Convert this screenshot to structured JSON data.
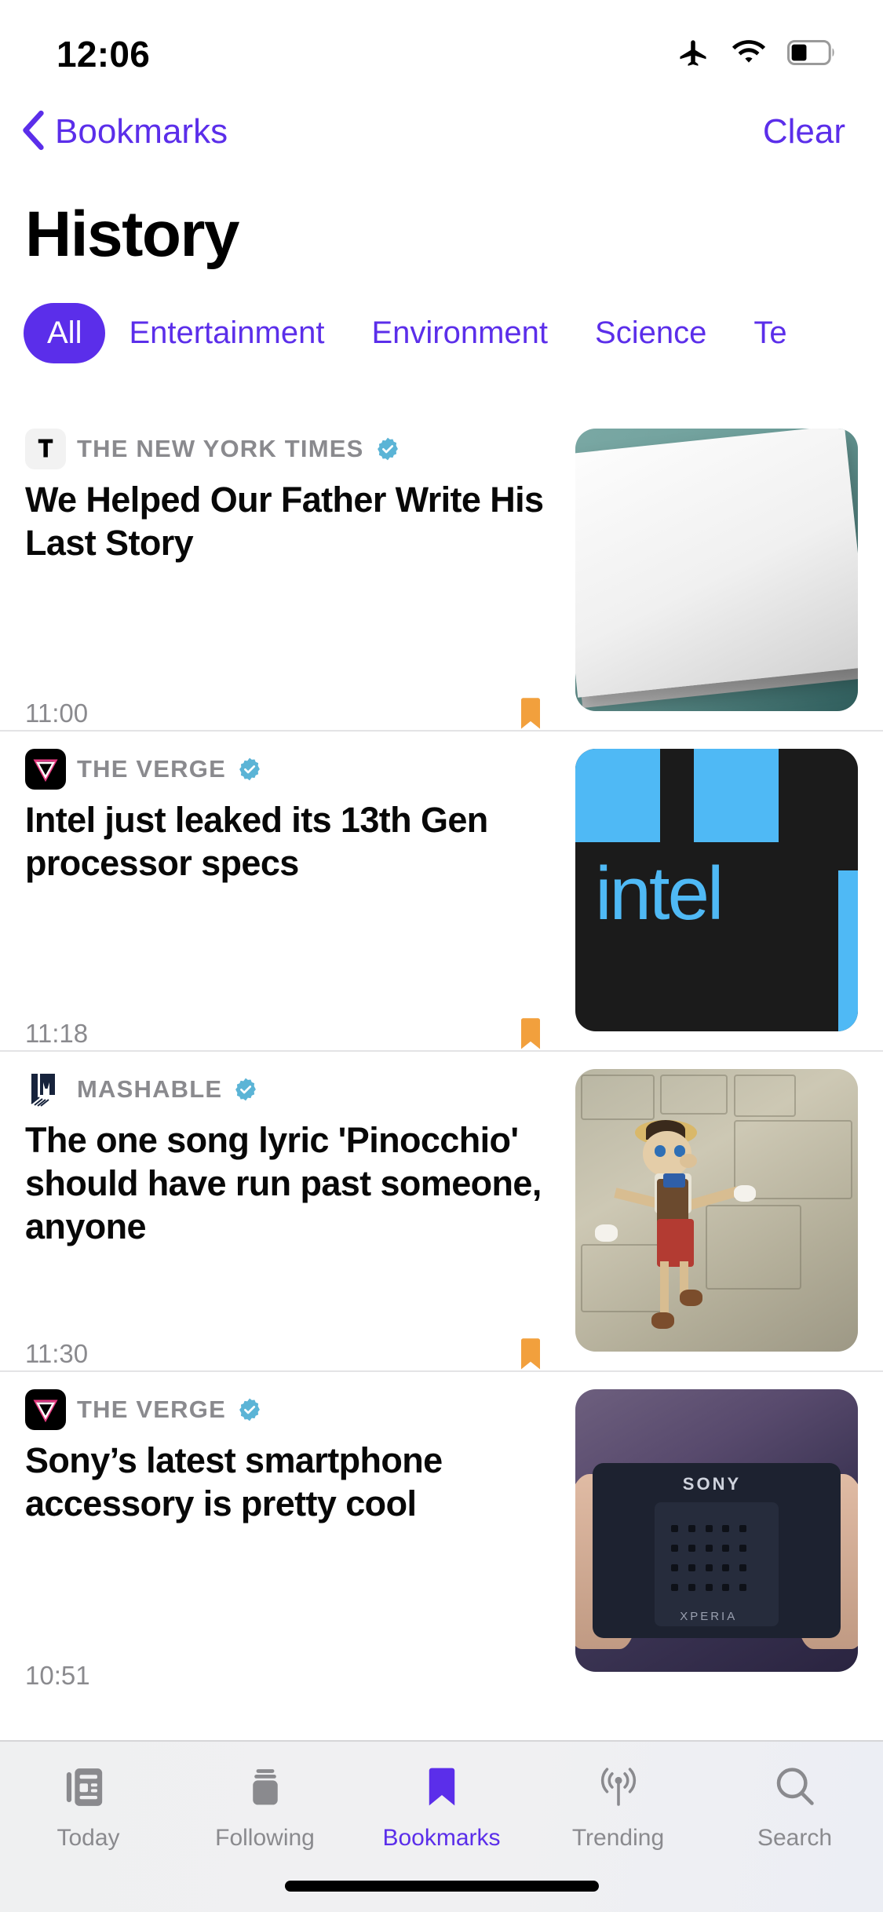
{
  "status_bar": {
    "time": "12:06",
    "icons": [
      "airplane-mode-icon",
      "wifi-icon",
      "battery-icon"
    ],
    "battery_level_pct": 38
  },
  "nav_bar": {
    "back_label": "Bookmarks",
    "back_icon": "chevron-left-icon",
    "clear_label": "Clear",
    "accent_color": "#5B2EEA"
  },
  "page_title": "History",
  "categories": [
    {
      "label": "All",
      "selected": true
    },
    {
      "label": "Entertainment",
      "selected": false
    },
    {
      "label": "Environment",
      "selected": false
    },
    {
      "label": "Science",
      "selected": false
    },
    {
      "label": "Te",
      "selected": false
    }
  ],
  "articles": [
    {
      "source": "THE NEW YORK TIMES",
      "source_logo": "nyt-logo-icon",
      "verified": true,
      "headline": "We Helped Our Father Write His Last Story",
      "timestamp": "11:00",
      "bookmarked": true,
      "thumbnail": "white-book-on-teal-photo"
    },
    {
      "source": "THE VERGE",
      "source_logo": "verge-logo-icon",
      "verified": true,
      "headline": "Intel just leaked its 13th Gen processor specs",
      "timestamp": "11:18",
      "bookmarked": true,
      "thumbnail": "intel-logo-image"
    },
    {
      "source": "MASHABLE",
      "source_logo": "mashable-logo-icon",
      "verified": true,
      "headline": "The one song lyric 'Pinocchio' should have run past someone, anyone",
      "timestamp": "11:30",
      "bookmarked": true,
      "thumbnail": "pinocchio-puppet-photo"
    },
    {
      "source": "THE VERGE",
      "source_logo": "verge-logo-icon",
      "verified": true,
      "headline": "Sony’s latest smartphone accessory is pretty cool",
      "timestamp": "10:51",
      "bookmarked": false,
      "thumbnail": "sony-xperia-cooler-photo"
    }
  ],
  "tab_bar": {
    "items": [
      {
        "label": "Today",
        "icon": "newspaper-icon",
        "active": false
      },
      {
        "label": "Following",
        "icon": "stack-icon",
        "active": false
      },
      {
        "label": "Bookmarks",
        "icon": "bookmark-icon",
        "active": true
      },
      {
        "label": "Trending",
        "icon": "broadcast-icon",
        "active": false
      },
      {
        "label": "Search",
        "icon": "magnifier-icon",
        "active": false
      }
    ],
    "active_color": "#5B2EEA",
    "inactive_color": "#8a8a8e"
  },
  "colors": {
    "accent": "#5B2EEA",
    "bookmark_flag": "#F2A03D",
    "verified_badge": "#5BB4D6",
    "source_text": "#8a8a8e"
  }
}
